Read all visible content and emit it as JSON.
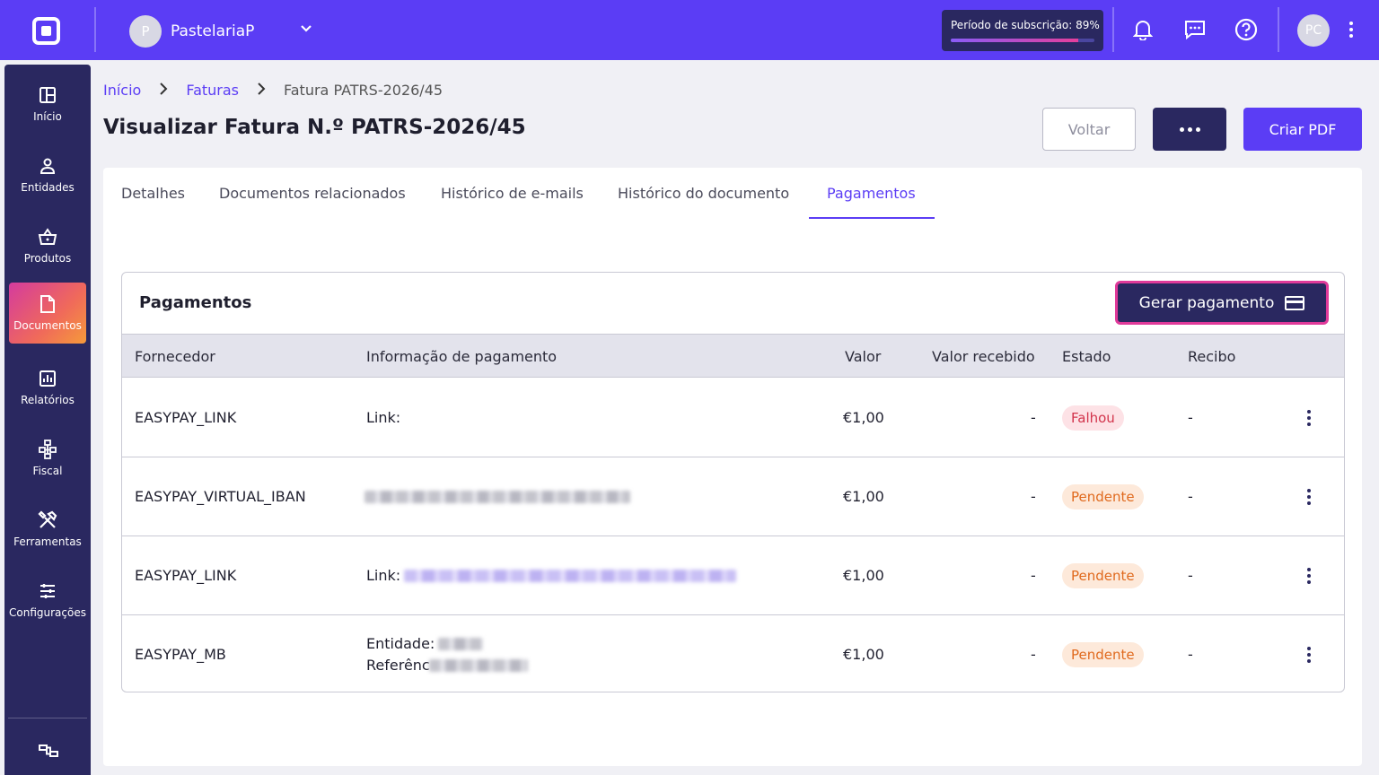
{
  "topbar": {
    "company_avatar": "P",
    "company_name": "PastelariaP",
    "subscription_label": "Período de subscrição: 89%",
    "subscription_progress": 0.89,
    "user_initials": "PC",
    "icons": [
      "logo-icon",
      "chevron-down-icon",
      "bell-icon",
      "chat-icon",
      "help-icon",
      "more-vertical-icon"
    ]
  },
  "sidebar": {
    "items": [
      {
        "label": "Início",
        "icon": "dashboard-icon"
      },
      {
        "label": "Entidades",
        "icon": "user-icon"
      },
      {
        "label": "Produtos",
        "icon": "basket-icon"
      },
      {
        "label": "Documentos",
        "icon": "document-icon",
        "active": true
      },
      {
        "label": "Relatórios",
        "icon": "chart-icon"
      },
      {
        "label": "Fiscal",
        "icon": "hierarchy-icon"
      },
      {
        "label": "Ferramentas",
        "icon": "tools-icon"
      },
      {
        "label": "Configurações",
        "icon": "sliders-icon"
      }
    ]
  },
  "breadcrumb": {
    "items": [
      "Início",
      "Faturas"
    ],
    "current": "Fatura PATRS-2026/45"
  },
  "page": {
    "title": "Visualizar Fatura N.º PATRS-2026/45",
    "back_label": "Voltar",
    "pdf_label": "Criar PDF"
  },
  "tabs": [
    {
      "label": "Detalhes"
    },
    {
      "label": "Documentos relacionados"
    },
    {
      "label": "Histórico de e-mails"
    },
    {
      "label": "Histórico do documento"
    },
    {
      "label": "Pagamentos",
      "active": true
    }
  ],
  "payments": {
    "title": "Pagamentos",
    "generate_label": "Gerar pagamento",
    "columns": [
      "Fornecedor",
      "Informação de pagamento",
      "Valor",
      "Valor recebido",
      "Estado",
      "Recibo"
    ],
    "rows": [
      {
        "provider": "EASYPAY_LINK",
        "info": "Link:",
        "value": "€1,00",
        "received": "-",
        "status": "Falhou",
        "status_type": "fail",
        "receipt": "-"
      },
      {
        "provider": "EASYPAY_VIRTUAL_IBAN",
        "info": "",
        "value": "€1,00",
        "received": "-",
        "status": "Pendente",
        "status_type": "pending",
        "receipt": "-"
      },
      {
        "provider": "EASYPAY_LINK",
        "info": "Link:",
        "value": "€1,00",
        "received": "-",
        "status": "Pendente",
        "status_type": "pending",
        "receipt": "-"
      },
      {
        "provider": "EASYPAY_MB",
        "info": "Entidade:",
        "info2": "Referênc",
        "value": "€1,00",
        "received": "-",
        "status": "Pendente",
        "status_type": "pending",
        "receipt": "-"
      }
    ]
  },
  "colors": {
    "primary": "#5b3df5",
    "navy": "#2a2860",
    "highlight_border": "#e03a9a",
    "fail": "#d2344c",
    "pending": "#e06a1e"
  }
}
